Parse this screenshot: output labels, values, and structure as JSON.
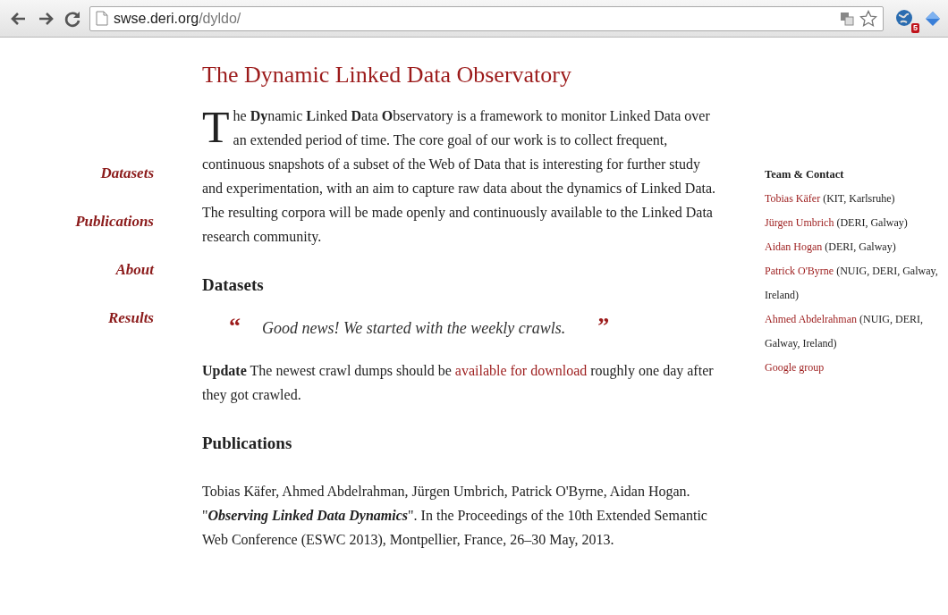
{
  "browser": {
    "url_host": "swse.deri.org",
    "url_path": "/dyldo/",
    "extension_badge": "5"
  },
  "nav": [
    {
      "label": "Datasets"
    },
    {
      "label": "Publications"
    },
    {
      "label": "About"
    },
    {
      "label": "Results"
    }
  ],
  "title": "The Dynamic Linked Data Observatory",
  "intro": "The **Dy**namic **L**inked **D**ata **O**bservatory is a framework to monitor Linked Data over an extended period of time. The core goal of our work is to collect frequent, continuous snapshots of a subset of the Web of Data that is interesting for further study and experimentation, with an aim to capture raw data about the dynamics of Linked Data. The resulting corpora will be made openly and continuously available to the Linked Data research community.",
  "datasets": {
    "heading": "Datasets",
    "quote_open": "“",
    "quote": "Good news! We started with the weekly crawls.",
    "quote_close": "”",
    "update_label": "Update",
    "update_before": "The newest crawl dumps should be",
    "update_link": "available for download",
    "update_after": "roughly one day after they got crawled."
  },
  "publications": {
    "heading": "Publications",
    "authors": "Tobias Käfer, Ahmed Abdelrahman, Jürgen Umbrich, Patrick O'Byrne, Aidan Hogan.",
    "cite_before": "\"",
    "cite_title": "Observing Linked Data Dynamics",
    "cite_after": "\". In the Proceedings of the 10th Extended Semantic Web Conference (ESWC 2013), Montpellier, France, 26–30 May, 2013."
  },
  "sidebar": {
    "heading": "Team & Contact",
    "contacts": [
      {
        "name": "Tobias Käfer",
        "affiliation": "(KIT, Karlsruhe)"
      },
      {
        "name": "Jürgen Umbrich",
        "affiliation": "(DERI, Galway)"
      },
      {
        "name": "Aidan Hogan",
        "affiliation": "(DERI, Galway)"
      },
      {
        "name": "Patrick O'Byrne",
        "affiliation": "(NUIG, DERI, Galway, Ireland)"
      },
      {
        "name": "Ahmed Abdelrahman",
        "affiliation": "(NUIG, DERI, Galway, Ireland)"
      },
      {
        "name": "Google group"
      }
    ]
  }
}
